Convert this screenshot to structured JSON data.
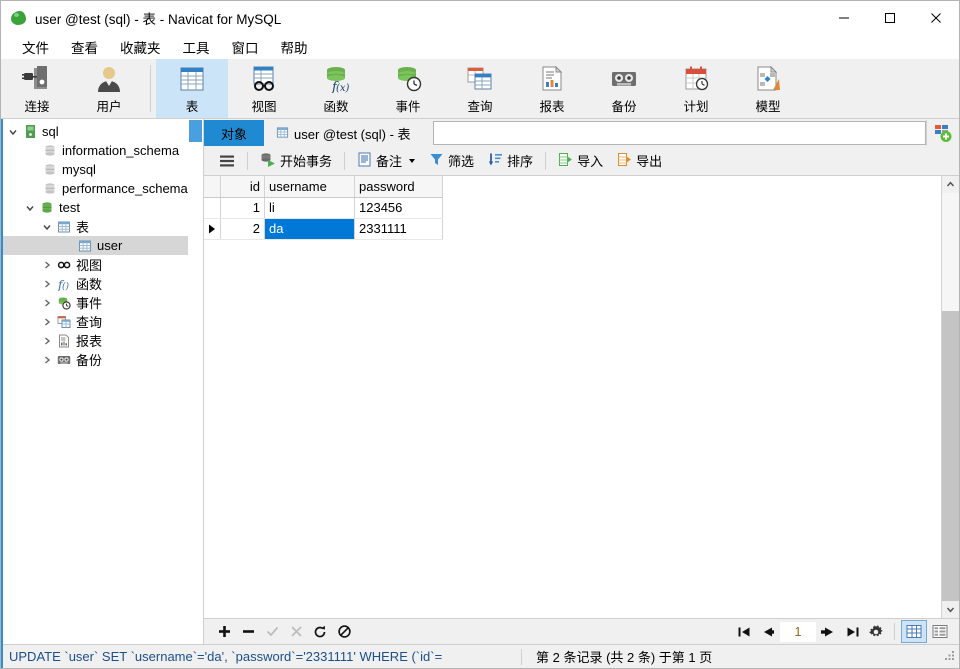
{
  "window": {
    "title": "user @test (sql) - 表 - Navicat for MySQL",
    "logo_icon": "navicat-leaf-icon",
    "minimize_icon": "minimize-icon",
    "maximize_icon": "maximize-icon",
    "close_icon": "close-icon"
  },
  "menu": {
    "items": [
      {
        "label": "文件",
        "name": "menu-file"
      },
      {
        "label": "查看",
        "name": "menu-view"
      },
      {
        "label": "收藏夹",
        "name": "menu-favorites"
      },
      {
        "label": "工具",
        "name": "menu-tools"
      },
      {
        "label": "窗口",
        "name": "menu-window"
      },
      {
        "label": "帮助",
        "name": "menu-help"
      }
    ]
  },
  "toolbar": {
    "items": [
      {
        "label": "连接",
        "icon": "connection-icon",
        "selected": false
      },
      {
        "label": "用户",
        "icon": "user-icon",
        "selected": false
      },
      {
        "label": "表",
        "icon": "table-icon",
        "selected": true
      },
      {
        "label": "视图",
        "icon": "view-icon",
        "selected": false
      },
      {
        "label": "函数",
        "icon": "function-icon",
        "selected": false
      },
      {
        "label": "事件",
        "icon": "event-icon",
        "selected": false
      },
      {
        "label": "查询",
        "icon": "query-icon",
        "selected": false
      },
      {
        "label": "报表",
        "icon": "report-icon",
        "selected": false
      },
      {
        "label": "备份",
        "icon": "backup-icon",
        "selected": false
      },
      {
        "label": "计划",
        "icon": "schedule-icon",
        "selected": false
      },
      {
        "label": "模型",
        "icon": "model-icon",
        "selected": false
      }
    ]
  },
  "sidebar": {
    "tree": [
      {
        "label": "sql",
        "icon": "server-icon",
        "depth": 0,
        "twist": "expanded",
        "selected": false
      },
      {
        "label": "information_schema",
        "icon": "database-gray-icon",
        "depth": 1,
        "twist": "none",
        "selected": false
      },
      {
        "label": "mysql",
        "icon": "database-gray-icon",
        "depth": 1,
        "twist": "none",
        "selected": false
      },
      {
        "label": "performance_schema",
        "icon": "database-gray-icon",
        "depth": 1,
        "twist": "none",
        "selected": false
      },
      {
        "label": "test",
        "icon": "database-green-icon",
        "depth": 1,
        "twist": "expanded",
        "selected": false
      },
      {
        "label": "表",
        "icon": "table-icon",
        "depth": 2,
        "twist": "expanded",
        "selected": false
      },
      {
        "label": "user",
        "icon": "table-icon",
        "depth": 3,
        "twist": "none",
        "selected": true
      },
      {
        "label": "视图",
        "icon": "view-icon",
        "depth": 2,
        "twist": "collapsed",
        "selected": false
      },
      {
        "label": "函数",
        "icon": "function-icon",
        "depth": 2,
        "twist": "collapsed",
        "selected": false
      },
      {
        "label": "事件",
        "icon": "event-icon",
        "depth": 2,
        "twist": "collapsed",
        "selected": false
      },
      {
        "label": "查询",
        "icon": "query-icon",
        "depth": 2,
        "twist": "collapsed",
        "selected": false
      },
      {
        "label": "报表",
        "icon": "report-icon",
        "depth": 2,
        "twist": "collapsed",
        "selected": false
      },
      {
        "label": "备份",
        "icon": "backup-icon",
        "depth": 2,
        "twist": "collapsed",
        "selected": false
      }
    ]
  },
  "tabs": {
    "object_tab": "对象",
    "doc_tab": "user @test (sql) - 表",
    "doc_tab_icon": "table-icon",
    "field_value": "",
    "add_icon": "new-object-icon"
  },
  "gridbar": {
    "menu_icon": "hamburger-icon",
    "items": [
      {
        "label": "开始事务",
        "icon": "begin-transaction-icon",
        "caret": false
      },
      {
        "label": "备注",
        "icon": "note-icon",
        "caret": true
      },
      {
        "label": "筛选",
        "icon": "filter-icon",
        "caret": false
      },
      {
        "label": "排序",
        "icon": "sort-icon",
        "caret": false
      },
      {
        "label": "导入",
        "icon": "import-icon",
        "caret": false
      },
      {
        "label": "导出",
        "icon": "export-icon",
        "caret": false
      }
    ]
  },
  "grid": {
    "columns": [
      {
        "label": "id",
        "highlighted": false
      },
      {
        "label": "username",
        "highlighted": true
      },
      {
        "label": "password",
        "highlighted": false
      }
    ],
    "rows": [
      {
        "indicator": "",
        "id": "1",
        "username": "li",
        "password": "123456",
        "current": false,
        "selected_cell": null
      },
      {
        "indicator": "row-arrow",
        "id": "2",
        "username": "da",
        "password": "2331111",
        "current": true,
        "selected_cell": "username"
      }
    ]
  },
  "editbar": {
    "buttons": [
      {
        "name": "add-record-button",
        "icon": "plus-icon",
        "enabled": true
      },
      {
        "name": "delete-record-button",
        "icon": "minus-icon",
        "enabled": true
      },
      {
        "name": "confirm-edit-button",
        "icon": "check-icon",
        "enabled": false
      },
      {
        "name": "cancel-edit-button",
        "icon": "cross-icon",
        "enabled": false
      },
      {
        "name": "refresh-button",
        "icon": "refresh-icon",
        "enabled": true
      },
      {
        "name": "stop-button",
        "icon": "stop-icon",
        "enabled": true
      }
    ],
    "pager": {
      "first_icon": "first-page-icon",
      "prev_icon": "prev-page-icon",
      "page_value": "1",
      "next_icon": "next-page-icon",
      "last_icon": "last-page-icon",
      "settings_icon": "gear-icon",
      "grid_view_icon": "grid-view-icon",
      "form_view_icon": "form-view-icon",
      "grid_view_active": true
    }
  },
  "statusbar": {
    "sql": "UPDATE `user` SET `username`='da', `password`='2331111' WHERE (`id`=",
    "record_info": "第 2 条记录 (共 2 条) 于第 1 页",
    "grip_icon": "resize-grip-icon"
  },
  "colors": {
    "accent_blue": "#1f8ad2",
    "selection_blue": "#0078d7",
    "header_highlight": "#d6e9f8",
    "tree_selection": "#d6d6d6",
    "toolbar_bg": "#f0f0f0",
    "sql_text": "#1a4f8a"
  }
}
